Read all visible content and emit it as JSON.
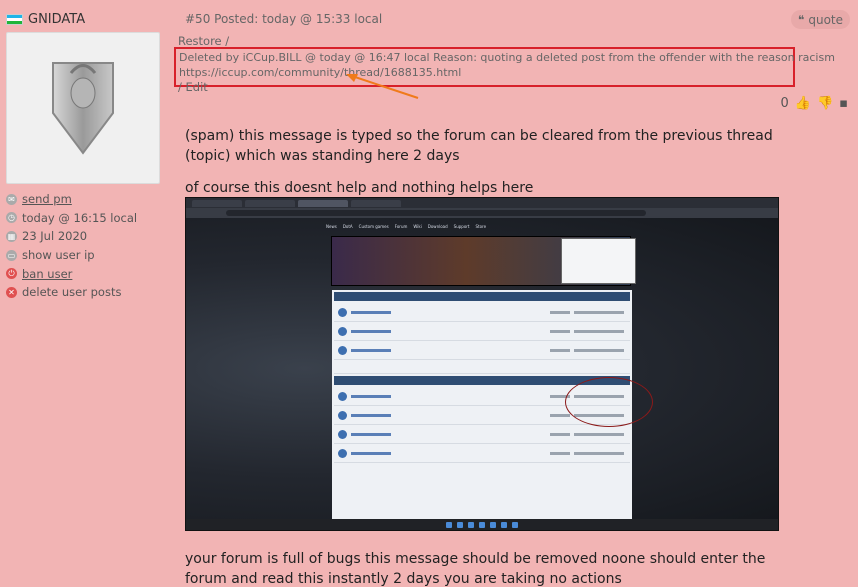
{
  "user": {
    "name": "GNIDATA",
    "flag_colors": [
      "#1eb4e8",
      "#ffffff",
      "#1eb53a"
    ],
    "links": [
      {
        "icon": "mail-icon",
        "label": "send pm",
        "underline": true
      },
      {
        "icon": "clock-icon",
        "label": "today @ 16:15 local",
        "underline": false
      },
      {
        "icon": "calendar-icon",
        "label": "23 Jul 2020",
        "underline": false
      },
      {
        "icon": "monitor-icon",
        "label": "show user ip",
        "underline": false
      },
      {
        "icon": "power-icon",
        "label": "ban user",
        "underline": true
      },
      {
        "icon": "delete-icon",
        "label": "delete user posts",
        "underline": false
      }
    ]
  },
  "post": {
    "header": "#50 Posted: today @ 15:33 local",
    "quote_label": "quote",
    "restore_label": "Restore  /",
    "deleted_line1": "Deleted by iCCup.BILL @ today @ 16:47 local Reason: quoting a deleted post from the offender with the reason racism",
    "deleted_line2": "https://iccup.com/community/thread/1688135.html",
    "edit_label": "/  Edit",
    "votes": "0",
    "body1": "(spam) this message is typed so the forum can be cleared from the previous thread (topic) which was standing here 2 days",
    "body2": "of course this doesnt help and nothing helps here",
    "body3": "your forum is full of bugs this message should be removed noone should enter the forum and read this instantly 2 days you are taking no actions"
  },
  "screenshot": {
    "nav": [
      "News",
      "DotA",
      "Custom games",
      "Forum",
      "Wiki",
      "Download",
      "Support",
      "Store"
    ]
  },
  "colors": {
    "page_bg": "#f2b4b4",
    "highlight_box": "#d8202a",
    "arrow": "#f07a1a"
  }
}
